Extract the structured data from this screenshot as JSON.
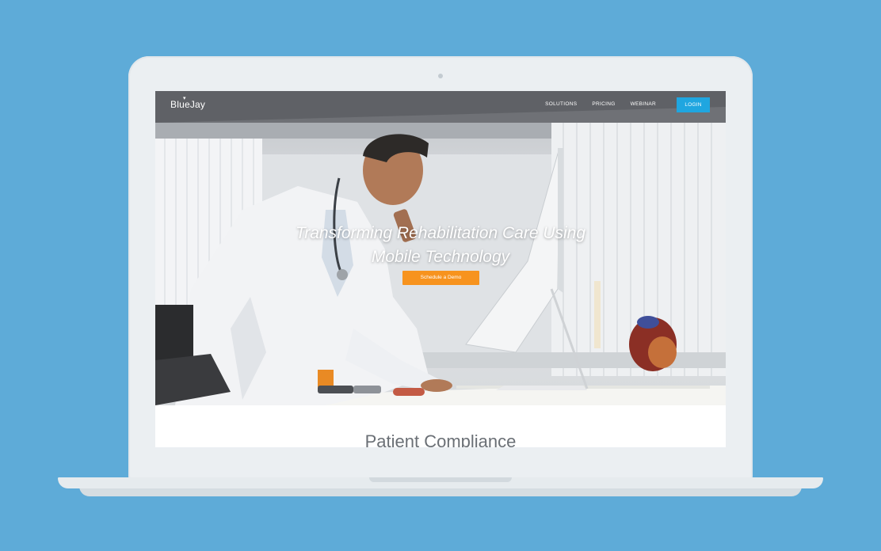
{
  "site": {
    "logo_text": "BlueJay",
    "nav": {
      "links": [
        "SOLUTIONS",
        "PRICING",
        "WEBINAR"
      ],
      "login_label": "LOGIN"
    },
    "hero": {
      "headline_line1": "Transforming Rehabilitation Care Using",
      "headline_line2": "Mobile Technology",
      "cta_label": "Schedule a Demo"
    },
    "section": {
      "title": "Patient Compliance"
    }
  },
  "colors": {
    "background": "#5eabd8",
    "accent_blue": "#1fa6e0",
    "cta_orange": "#f7931e"
  },
  "icons": [
    "laptop-camera-icon",
    "bird-logo-icon"
  ]
}
